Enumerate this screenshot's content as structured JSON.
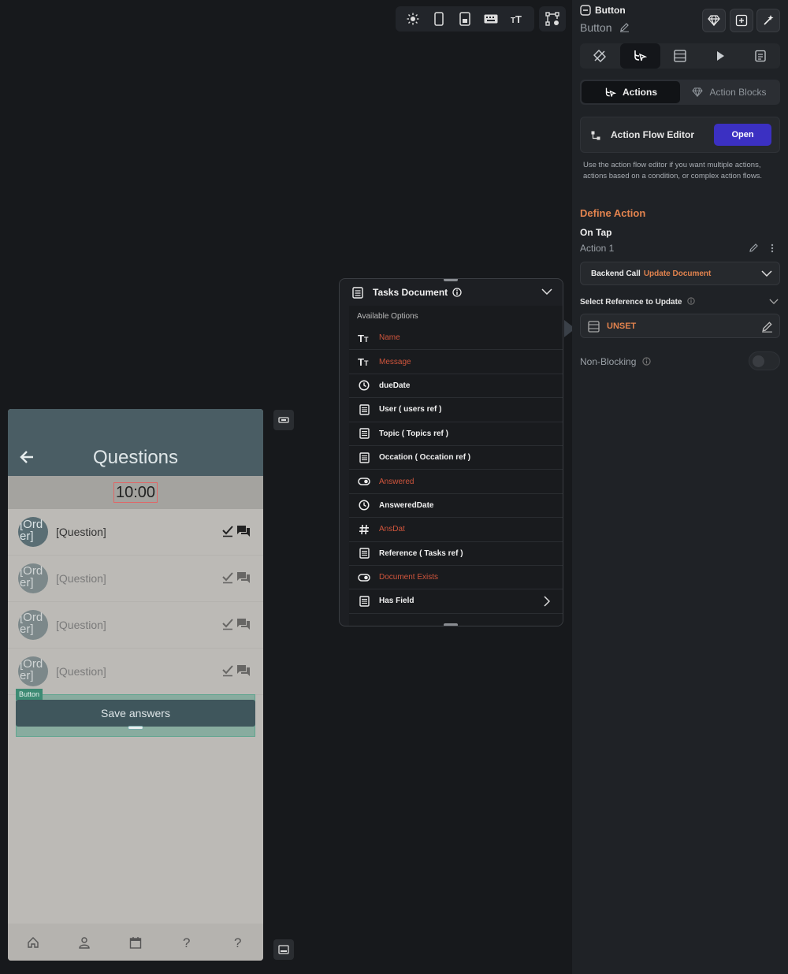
{
  "toolbar": {
    "icons": [
      "sun-icon",
      "phone-icon",
      "tablet-icon",
      "keyboard-icon",
      "text-size-icon"
    ],
    "extra_icon": "node-tree-icon"
  },
  "phone": {
    "title": "Questions",
    "timer": "10:00",
    "questions": [
      {
        "avatar": "[Ord\ner]",
        "text": "[Question]"
      },
      {
        "avatar": "[Ord\ner]",
        "text": "[Question]"
      },
      {
        "avatar": "[Ord\ner]",
        "text": "[Question]"
      },
      {
        "avatar": "[Ord\ner]",
        "text": "[Question]"
      }
    ],
    "button_tag": "Button",
    "save_label": "Save answers",
    "nav_icons": [
      "home-icon",
      "person-icon",
      "calendar-icon",
      "help-icon",
      "help-icon"
    ]
  },
  "dropdown": {
    "title": "Tasks Document",
    "subtitle": "Available Options",
    "items": [
      {
        "label": "Name",
        "icon": "text-type-icon",
        "style": "red"
      },
      {
        "label": "Message",
        "icon": "text-type-icon",
        "style": "red"
      },
      {
        "label": "dueDate",
        "icon": "clock-icon",
        "style": "normal"
      },
      {
        "label": "User  ( users ref )",
        "icon": "document-icon",
        "style": "normal"
      },
      {
        "label": "Topic  ( Topics ref )",
        "icon": "document-icon",
        "style": "normal"
      },
      {
        "label": "Occation  ( Occation ref )",
        "icon": "document-icon",
        "style": "normal"
      },
      {
        "label": "Answered",
        "icon": "toggle-icon",
        "style": "red"
      },
      {
        "label": "AnsweredDate",
        "icon": "clock-icon",
        "style": "normal"
      },
      {
        "label": "AnsDat",
        "icon": "hash-icon",
        "style": "red"
      },
      {
        "label": "Reference  ( Tasks ref )",
        "icon": "document-icon",
        "style": "normal"
      },
      {
        "label": "Document Exists",
        "icon": "toggle-icon",
        "style": "red"
      },
      {
        "label": "Has Field",
        "icon": "document-icon",
        "style": "normal"
      }
    ]
  },
  "panel": {
    "widget_type": "Button",
    "widget_name": "Button",
    "tabs": [
      "paint-icon",
      "actions-icon",
      "backend-icon",
      "play-icon",
      "doc-list-icon"
    ],
    "seg_actions": "Actions",
    "seg_blocks": "Action Blocks",
    "flow_editor_label": "Action Flow Editor",
    "open_label": "Open",
    "help_text": "Use the action flow editor if you want multiple actions, actions based on a condition, or complex action flows.",
    "define_action": "Define Action",
    "on_tap": "On Tap",
    "action1": "Action 1",
    "backend_call": "Backend Call",
    "update_document": "Update Document",
    "select_ref_label": "Select Reference to Update",
    "unset": "UNSET",
    "non_blocking": "Non-Blocking"
  },
  "colors": {
    "accent_orange": "#e2834e",
    "primary_button": "#3b30c2",
    "warning_red": "#d0553c",
    "app_bar": "#4a5d64"
  }
}
